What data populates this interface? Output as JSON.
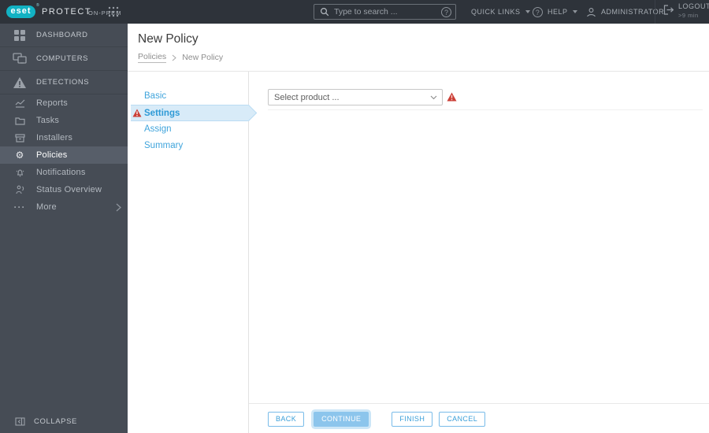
{
  "topbar": {
    "logo_text": "eset",
    "logo_reg": "®",
    "product_name": "PROTECT",
    "product_suffix": "ON-PREM",
    "search": {
      "placeholder": "Type to search ...",
      "icon": "search-icon",
      "help_icon": "help-circle-icon"
    },
    "quick_links_label": "QUICK LINKS",
    "help_label": "HELP",
    "user_label": "ADMINISTRATOR",
    "logout_label": "LOGOUT",
    "logout_timer": ">9 min",
    "icons": [
      "apps-grid-icon",
      "caret-down-icon",
      "user-icon",
      "logout-icon"
    ]
  },
  "sidebar": {
    "primary_items": [
      {
        "label": "DASHBOARD",
        "icon": "dashboard-icon"
      },
      {
        "label": "COMPUTERS",
        "icon": "computers-icon"
      },
      {
        "label": "DETECTIONS",
        "icon": "detections-icon"
      }
    ],
    "secondary_items": [
      {
        "label": "Reports",
        "icon": "reports-icon",
        "active": false
      },
      {
        "label": "Tasks",
        "icon": "tasks-icon",
        "active": false
      },
      {
        "label": "Installers",
        "icon": "installers-icon",
        "active": false
      },
      {
        "label": "Policies",
        "icon": "policies-gear-icon",
        "active": true
      },
      {
        "label": "Notifications",
        "icon": "notifications-bell-icon",
        "active": false
      },
      {
        "label": "Status Overview",
        "icon": "status-overview-icon",
        "active": false
      },
      {
        "label": "More",
        "icon": "more-ellipsis-icon",
        "has_submenu": true
      }
    ],
    "collapse_label": "COLLAPSE",
    "collapse_icon": "collapse-icon"
  },
  "header": {
    "title": "New Policy",
    "breadcrumb": {
      "parent": "Policies",
      "current": "New Policy"
    }
  },
  "wizard": {
    "steps": [
      {
        "label": "Basic",
        "active": false,
        "warning": false
      },
      {
        "label": "Settings",
        "active": true,
        "warning": true
      },
      {
        "label": "Assign",
        "active": false,
        "warning": false
      },
      {
        "label": "Summary",
        "active": false,
        "warning": false
      }
    ]
  },
  "content": {
    "product_select": {
      "value": "Select product ...",
      "warning": true,
      "warning_icon": "warning-triangle-icon"
    }
  },
  "footer": {
    "buttons": [
      {
        "label": "BACK",
        "primary": false
      },
      {
        "label": "CONTINUE",
        "primary": true
      },
      {
        "label": "FINISH",
        "primary": false
      },
      {
        "label": "CANCEL",
        "primary": false
      }
    ]
  },
  "colors": {
    "topbar_bg": "#2e333a",
    "sidebar_bg": "#464c55",
    "sidebar_active_bg": "#575e69",
    "eset_teal": "#12b2c3",
    "accent_blue": "#41a5dc",
    "step_active_bg": "#d8ebf8",
    "warning_red": "#cb3e35",
    "button_fill_blue": "#8cc5ec"
  }
}
